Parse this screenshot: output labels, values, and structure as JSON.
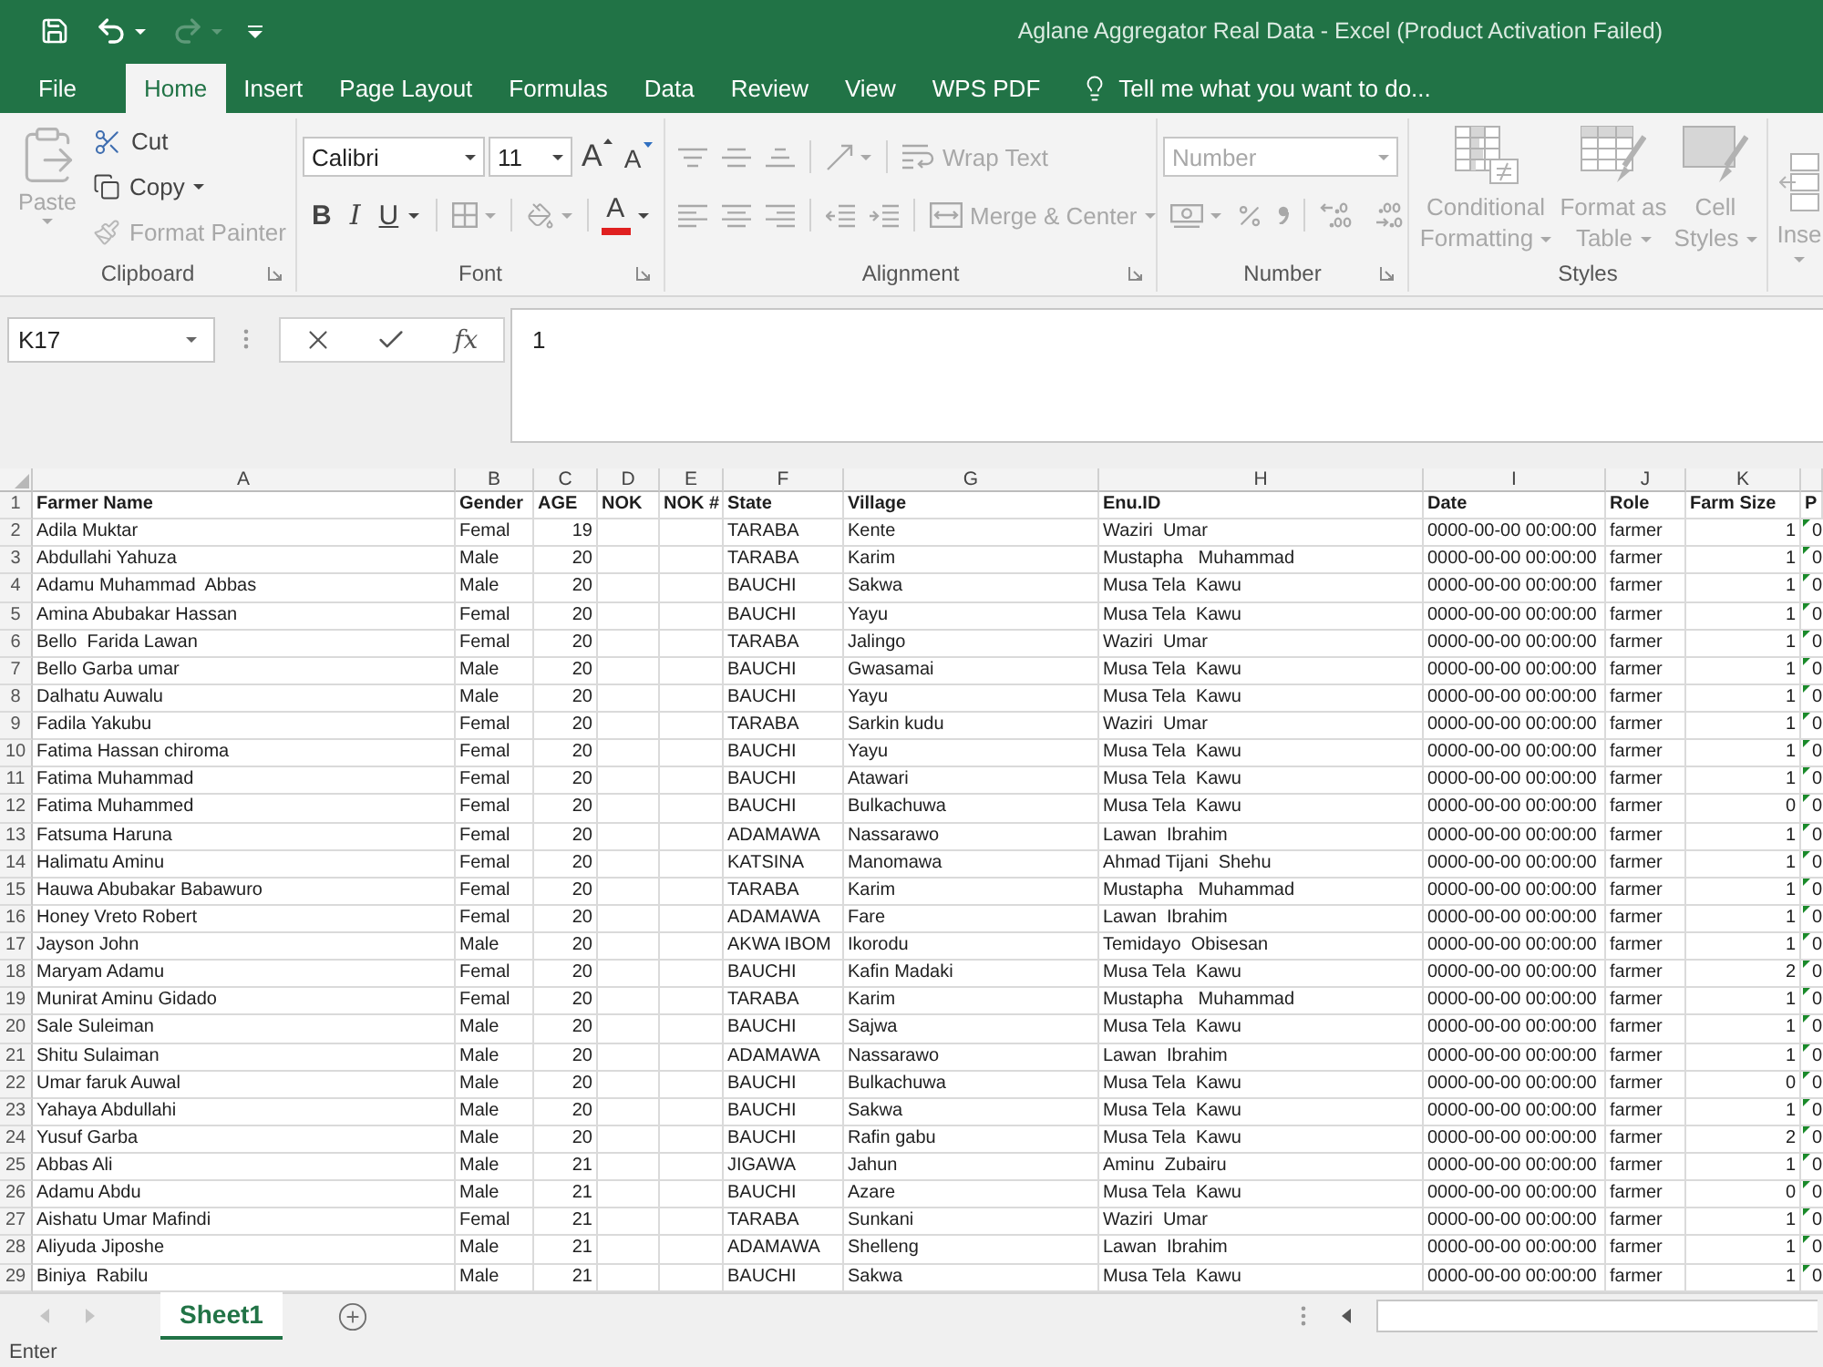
{
  "window": {
    "title": "Aglane Aggregator Real Data - Excel (Product Activation Failed)"
  },
  "quick_access": [
    {
      "kind": "save",
      "disabled": false
    },
    {
      "kind": "undo",
      "disabled": false
    },
    {
      "kind": "redo",
      "disabled": true
    },
    {
      "kind": "customize",
      "disabled": false
    }
  ],
  "ribbon_tabs": [
    {
      "label": "File",
      "selected": false
    },
    {
      "label": "Home",
      "selected": true
    },
    {
      "label": "Insert",
      "selected": false
    },
    {
      "label": "Page Layout",
      "selected": false
    },
    {
      "label": "Formulas",
      "selected": false
    },
    {
      "label": "Data",
      "selected": false
    },
    {
      "label": "Review",
      "selected": false
    },
    {
      "label": "View",
      "selected": false
    },
    {
      "label": "WPS PDF",
      "selected": false
    }
  ],
  "tell_me": {
    "label": "Tell me what you want to do..."
  },
  "ribbon": {
    "clipboard": {
      "label": "Clipboard",
      "paste": {
        "label": "Paste",
        "disabled": true
      },
      "small_buttons": [
        {
          "kind": "cut",
          "label": "Cut",
          "disabled": false
        },
        {
          "kind": "copy",
          "label": "Copy",
          "disabled": false
        },
        {
          "kind": "format_painter",
          "label": "Format Painter",
          "disabled": true
        }
      ]
    },
    "font": {
      "label": "Font",
      "font_name": {
        "value": "Calibri"
      },
      "font_size": {
        "value": "11"
      },
      "size_buttons": [
        {
          "kind": "grow",
          "label": "A",
          "disabled": false
        },
        {
          "kind": "shrink",
          "label": "A",
          "disabled": false
        }
      ],
      "format_buttons": [
        {
          "kind": "bold",
          "label": "B",
          "disabled": false
        },
        {
          "kind": "italic",
          "label": "I",
          "disabled": false
        },
        {
          "kind": "underline",
          "label": "U",
          "disabled": false
        },
        {
          "kind": "borders",
          "disabled": true
        },
        {
          "kind": "fill_color",
          "disabled": true
        },
        {
          "kind": "font_color",
          "label": "A",
          "disabled": false
        }
      ]
    },
    "alignment": {
      "label": "Alignment",
      "top_row": [
        {
          "kind": "align_top",
          "disabled": true
        },
        {
          "kind": "align_middle",
          "disabled": true
        },
        {
          "kind": "align_bottom",
          "disabled": true
        },
        {
          "kind": "orientation",
          "disabled": true
        },
        {
          "kind": "wrap_text",
          "label": "Wrap Text",
          "disabled": true
        }
      ],
      "bottom_row": [
        {
          "kind": "align_left",
          "disabled": true
        },
        {
          "kind": "align_center",
          "disabled": true
        },
        {
          "kind": "align_right",
          "disabled": true
        },
        {
          "kind": "indent_decrease",
          "disabled": true
        },
        {
          "kind": "indent_increase",
          "disabled": true
        },
        {
          "kind": "merge_center",
          "label": "Merge & Center",
          "disabled": true
        }
      ]
    },
    "number": {
      "label": "Number",
      "format": {
        "value": "Number",
        "disabled": true
      },
      "buttons": [
        {
          "kind": "currency",
          "disabled": true
        },
        {
          "kind": "percent",
          "disabled": true
        },
        {
          "kind": "comma",
          "disabled": true
        },
        {
          "kind": "increase_decimal",
          "disabled": true
        },
        {
          "kind": "decrease_decimal",
          "disabled": true
        }
      ]
    },
    "styles": {
      "label": "Styles",
      "buttons": [
        {
          "kind": "conditional_formatting",
          "label": "Conditional Formatting",
          "disabled": true
        },
        {
          "kind": "format_as_table",
          "label": "Format as Table",
          "disabled": true
        },
        {
          "kind": "cell_styles",
          "label": "Cell Styles",
          "disabled": true
        }
      ]
    },
    "cells": {
      "insert": {
        "label": "Inse",
        "disabled": true
      }
    }
  },
  "formula_bar": {
    "name_box": {
      "value": "K17"
    },
    "function_label": "fx",
    "formula": {
      "value": "1"
    }
  },
  "grid": {
    "columns": [
      {
        "letter": "A",
        "kind": "text"
      },
      {
        "letter": "B",
        "kind": "text"
      },
      {
        "letter": "C",
        "kind": "number"
      },
      {
        "letter": "D",
        "kind": "text"
      },
      {
        "letter": "E",
        "kind": "text"
      },
      {
        "letter": "F",
        "kind": "text"
      },
      {
        "letter": "G",
        "kind": "text"
      },
      {
        "letter": "H",
        "kind": "text"
      },
      {
        "letter": "I",
        "kind": "text"
      },
      {
        "letter": "J",
        "kind": "text"
      },
      {
        "letter": "K",
        "kind": "number"
      }
    ],
    "header_row": {
      "number": "1",
      "farmer_name": "Farmer Name",
      "gender": "Gender",
      "age": "AGE",
      "nok": "NOK",
      "nok_number": "NOK #",
      "state": "State",
      "village": "Village",
      "enu_id": "Enu.ID",
      "date": "Date",
      "role": "Role",
      "farm_size": "Farm Size",
      "column_12": "P"
    },
    "rows": [
      {
        "number": "2",
        "farmer_name": "Adila Muktar",
        "gender": "Femal",
        "age": "19",
        "state": "TARABA",
        "village": "Kente",
        "enu_id": "Waziri  Umar",
        "date": "0000-00-00 00:00:00",
        "role": "farmer",
        "farm_size": "1",
        "column_12": "0",
        "flagged": true
      },
      {
        "number": "3",
        "farmer_name": "Abdullahi Yahuza",
        "gender": "Male",
        "age": "20",
        "state": "TARABA",
        "village": "Karim",
        "enu_id": "Mustapha   Muhammad",
        "date": "0000-00-00 00:00:00",
        "role": "farmer",
        "farm_size": "1",
        "column_12": "0",
        "flagged": true
      },
      {
        "number": "4",
        "farmer_name": "Adamu Muhammad  Abbas",
        "gender": "Male",
        "age": "20",
        "state": "BAUCHI",
        "village": "Sakwa",
        "enu_id": "Musa Tela  Kawu",
        "date": "0000-00-00 00:00:00",
        "role": "farmer",
        "farm_size": "1",
        "column_12": "0",
        "flagged": true
      },
      {
        "number": "5",
        "farmer_name": "Amina Abubakar Hassan",
        "gender": "Femal",
        "age": "20",
        "state": "BAUCHI",
        "village": "Yayu",
        "enu_id": "Musa Tela  Kawu",
        "date": "0000-00-00 00:00:00",
        "role": "farmer",
        "farm_size": "1",
        "column_12": "0",
        "flagged": true
      },
      {
        "number": "6",
        "farmer_name": "Bello  Farida Lawan",
        "gender": "Femal",
        "age": "20",
        "state": "TARABA",
        "village": "Jalingo",
        "enu_id": "Waziri  Umar",
        "date": "0000-00-00 00:00:00",
        "role": "farmer",
        "farm_size": "1",
        "column_12": "0",
        "flagged": true
      },
      {
        "number": "7",
        "farmer_name": "Bello Garba umar",
        "gender": "Male",
        "age": "20",
        "state": "BAUCHI",
        "village": "Gwasamai",
        "enu_id": "Musa Tela  Kawu",
        "date": "0000-00-00 00:00:00",
        "role": "farmer",
        "farm_size": "1",
        "column_12": "0",
        "flagged": true
      },
      {
        "number": "8",
        "farmer_name": "Dalhatu Auwalu",
        "gender": "Male",
        "age": "20",
        "state": "BAUCHI",
        "village": "Yayu",
        "enu_id": "Musa Tela  Kawu",
        "date": "0000-00-00 00:00:00",
        "role": "farmer",
        "farm_size": "1",
        "column_12": "0",
        "flagged": true
      },
      {
        "number": "9",
        "farmer_name": "Fadila Yakubu",
        "gender": "Femal",
        "age": "20",
        "state": "TARABA",
        "village": "Sarkin kudu",
        "enu_id": "Waziri  Umar",
        "date": "0000-00-00 00:00:00",
        "role": "farmer",
        "farm_size": "1",
        "column_12": "0",
        "flagged": true
      },
      {
        "number": "10",
        "farmer_name": "Fatima Hassan chiroma",
        "gender": "Femal",
        "age": "20",
        "state": "BAUCHI",
        "village": "Yayu",
        "enu_id": "Musa Tela  Kawu",
        "date": "0000-00-00 00:00:00",
        "role": "farmer",
        "farm_size": "1",
        "column_12": "0",
        "flagged": true
      },
      {
        "number": "11",
        "farmer_name": "Fatima Muhammad",
        "gender": "Femal",
        "age": "20",
        "state": "BAUCHI",
        "village": "Atawari",
        "enu_id": "Musa Tela  Kawu",
        "date": "0000-00-00 00:00:00",
        "role": "farmer",
        "farm_size": "1",
        "column_12": "0",
        "flagged": true
      },
      {
        "number": "12",
        "farmer_name": "Fatima Muhammed",
        "gender": "Femal",
        "age": "20",
        "state": "BAUCHI",
        "village": "Bulkachuwa",
        "enu_id": "Musa Tela  Kawu",
        "date": "0000-00-00 00:00:00",
        "role": "farmer",
        "farm_size": "0",
        "column_12": "0",
        "flagged": true
      },
      {
        "number": "13",
        "farmer_name": "Fatsuma Haruna",
        "gender": "Femal",
        "age": "20",
        "state": "ADAMAWA",
        "village": "Nassarawo",
        "enu_id": "Lawan  Ibrahim",
        "date": "0000-00-00 00:00:00",
        "role": "farmer",
        "farm_size": "1",
        "column_12": "0",
        "flagged": true
      },
      {
        "number": "14",
        "farmer_name": "Halimatu Aminu",
        "gender": "Femal",
        "age": "20",
        "state": "KATSINA",
        "village": "Manomawa",
        "enu_id": "Ahmad Tijani  Shehu",
        "date": "0000-00-00 00:00:00",
        "role": "farmer",
        "farm_size": "1",
        "column_12": "0",
        "flagged": true
      },
      {
        "number": "15",
        "farmer_name": "Hauwa Abubakar Babawuro",
        "gender": "Femal",
        "age": "20",
        "state": "TARABA",
        "village": "Karim",
        "enu_id": "Mustapha   Muhammad",
        "date": "0000-00-00 00:00:00",
        "role": "farmer",
        "farm_size": "1",
        "column_12": "0",
        "flagged": true
      },
      {
        "number": "16",
        "farmer_name": "Honey Vreto Robert",
        "gender": "Femal",
        "age": "20",
        "state": "ADAMAWA",
        "village": "Fare",
        "enu_id": "Lawan  Ibrahim",
        "date": "0000-00-00 00:00:00",
        "role": "farmer",
        "farm_size": "1",
        "column_12": "0",
        "flagged": true
      },
      {
        "number": "17",
        "farmer_name": "Jayson John",
        "gender": "Male",
        "age": "20",
        "state": "AKWA IBOM",
        "village": "Ikorodu",
        "enu_id": "Temidayo  Obisesan",
        "date": "0000-00-00 00:00:00",
        "role": "farmer",
        "farm_size": "1",
        "column_12": "0",
        "flagged": true
      },
      {
        "number": "18",
        "farmer_name": "Maryam Adamu",
        "gender": "Femal",
        "age": "20",
        "state": "BAUCHI",
        "village": "Kafin Madaki",
        "enu_id": "Musa Tela  Kawu",
        "date": "0000-00-00 00:00:00",
        "role": "farmer",
        "farm_size": "2",
        "column_12": "0",
        "flagged": true
      },
      {
        "number": "19",
        "farmer_name": "Munirat Aminu Gidado",
        "gender": "Femal",
        "age": "20",
        "state": "TARABA",
        "village": "Karim",
        "enu_id": "Mustapha   Muhammad",
        "date": "0000-00-00 00:00:00",
        "role": "farmer",
        "farm_size": "1",
        "column_12": "0",
        "flagged": true
      },
      {
        "number": "20",
        "farmer_name": "Sale Suleiman",
        "gender": "Male",
        "age": "20",
        "state": "BAUCHI",
        "village": "Sajwa",
        "enu_id": "Musa Tela  Kawu",
        "date": "0000-00-00 00:00:00",
        "role": "farmer",
        "farm_size": "1",
        "column_12": "0",
        "flagged": true
      },
      {
        "number": "21",
        "farmer_name": "Shitu Sulaiman",
        "gender": "Male",
        "age": "20",
        "state": "ADAMAWA",
        "village": "Nassarawo",
        "enu_id": "Lawan  Ibrahim",
        "date": "0000-00-00 00:00:00",
        "role": "farmer",
        "farm_size": "1",
        "column_12": "0",
        "flagged": true
      },
      {
        "number": "22",
        "farmer_name": "Umar faruk Auwal",
        "gender": "Male",
        "age": "20",
        "state": "BAUCHI",
        "village": "Bulkachuwa",
        "enu_id": "Musa Tela  Kawu",
        "date": "0000-00-00 00:00:00",
        "role": "farmer",
        "farm_size": "0",
        "column_12": "0",
        "flagged": true
      },
      {
        "number": "23",
        "farmer_name": "Yahaya Abdullahi",
        "gender": "Male",
        "age": "20",
        "state": "BAUCHI",
        "village": "Sakwa",
        "enu_id": "Musa Tela  Kawu",
        "date": "0000-00-00 00:00:00",
        "role": "farmer",
        "farm_size": "1",
        "column_12": "0",
        "flagged": true
      },
      {
        "number": "24",
        "farmer_name": "Yusuf Garba",
        "gender": "Male",
        "age": "20",
        "state": "BAUCHI",
        "village": "Rafin gabu",
        "enu_id": "Musa Tela  Kawu",
        "date": "0000-00-00 00:00:00",
        "role": "farmer",
        "farm_size": "2",
        "column_12": "0",
        "flagged": true
      },
      {
        "number": "25",
        "farmer_name": "Abbas Ali",
        "gender": "Male",
        "age": "21",
        "state": "JIGAWA",
        "village": "Jahun",
        "enu_id": "Aminu  Zubairu",
        "date": "0000-00-00 00:00:00",
        "role": "farmer",
        "farm_size": "1",
        "column_12": "0",
        "flagged": true
      },
      {
        "number": "26",
        "farmer_name": "Adamu Abdu",
        "gender": "Male",
        "age": "21",
        "state": "BAUCHI",
        "village": "Azare",
        "enu_id": "Musa Tela  Kawu",
        "date": "0000-00-00 00:00:00",
        "role": "farmer",
        "farm_size": "0",
        "column_12": "0",
        "flagged": true
      },
      {
        "number": "27",
        "farmer_name": "Aishatu Umar Mafindi",
        "gender": "Femal",
        "age": "21",
        "state": "TARABA",
        "village": "Sunkani",
        "enu_id": "Waziri  Umar",
        "date": "0000-00-00 00:00:00",
        "role": "farmer",
        "farm_size": "1",
        "column_12": "0",
        "flagged": true
      },
      {
        "number": "28",
        "farmer_name": "Aliyuda Jiposhe",
        "gender": "Male",
        "age": "21",
        "state": "ADAMAWA",
        "village": "Shelleng",
        "enu_id": "Lawan  Ibrahim",
        "date": "0000-00-00 00:00:00",
        "role": "farmer",
        "farm_size": "1",
        "column_12": "0",
        "flagged": true
      },
      {
        "number": "29",
        "farmer_name": "Biniya  Rabilu",
        "gender": "Male",
        "age": "21",
        "state": "BAUCHI",
        "village": "Sakwa",
        "enu_id": "Musa Tela  Kawu",
        "date": "0000-00-00 00:00:00",
        "role": "farmer",
        "farm_size": "1",
        "column_12": "0",
        "flagged": true
      }
    ]
  },
  "sheet_tabs": [
    {
      "label": "Sheet1",
      "selected": true
    }
  ],
  "status_bar": {
    "mode": "Enter"
  }
}
